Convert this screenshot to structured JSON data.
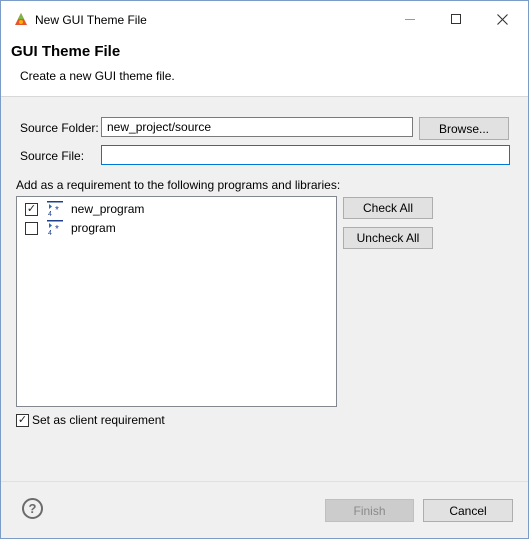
{
  "window": {
    "title": "New GUI Theme File",
    "icons": {
      "app": "eclipse-gui-icon",
      "minimize": "minimize-icon",
      "maximize": "maximize-icon",
      "close": "close-icon"
    }
  },
  "header": {
    "title": "GUI Theme File",
    "description": "Create a new GUI theme file."
  },
  "form": {
    "source_folder_label": "Source Folder:",
    "source_folder_value": "new_project/source",
    "browse_label": "Browse...",
    "source_file_label": "Source File:",
    "source_file_value": ""
  },
  "requirements": {
    "label": "Add as a requirement to the following programs and libraries:",
    "items": [
      {
        "label": "new_program",
        "checked": true,
        "icon": "program-icon"
      },
      {
        "label": "program",
        "checked": false,
        "icon": "program-icon"
      }
    ],
    "check_all_label": "Check All",
    "uncheck_all_label": "Uncheck All"
  },
  "client_requirement": {
    "label": "Set as client requirement",
    "checked": true
  },
  "footer": {
    "help_icon": "help-icon",
    "finish_label": "Finish",
    "cancel_label": "Cancel"
  },
  "colors": {
    "focus_border": "#0078d7",
    "window_border": "#7a9cc7"
  }
}
